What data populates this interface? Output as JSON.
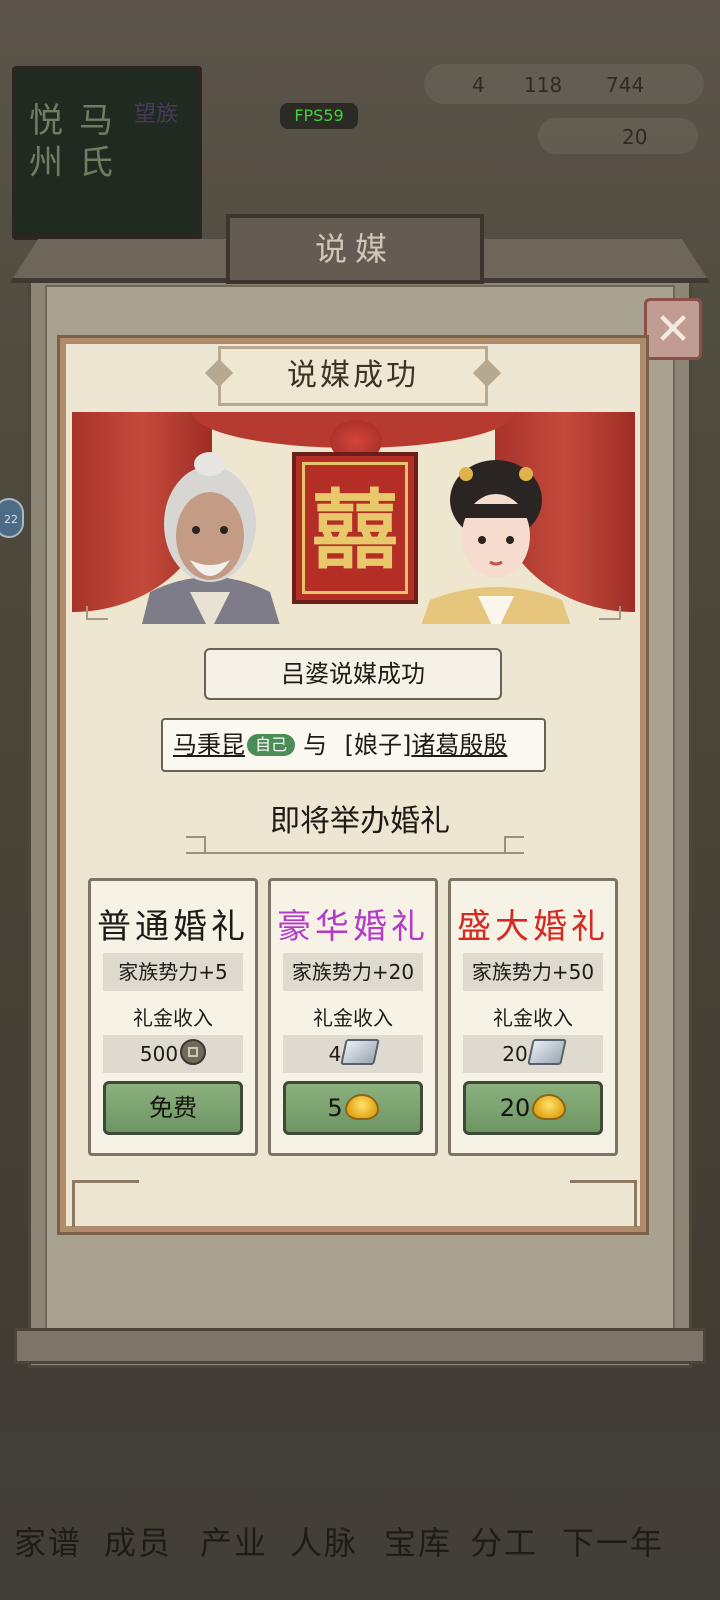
{
  "background": {
    "book_title_col1": "悦州",
    "book_title_col2": "马氏",
    "book_title_col3": "望族",
    "resources": {
      "a": "4",
      "b": "118",
      "c": "744"
    },
    "gold": "20",
    "fps": "FPS59",
    "side_badge": "22"
  },
  "dialog": {
    "title": "说媒",
    "close_icon": "close-x-icon"
  },
  "panel": {
    "ribbon_title": "说媒成功",
    "result_text": "吕婆说媒成功",
    "groom_name": "马秉昆",
    "self_tag": "自己",
    "conjunction": "与",
    "bride_prefix": "[娘子]",
    "bride_name": "诸葛殷殷",
    "soon_text": "即将举办婚礼",
    "double_happiness": "囍"
  },
  "weddings": [
    {
      "title": "普通婚礼",
      "title_color": "#1e1b17",
      "power": "家族势力+5",
      "gift_label": "礼金收入",
      "gift_value": "500",
      "gift_icon": "copper-coin-icon",
      "button_label": "免费",
      "button_icon": ""
    },
    {
      "title": "豪华婚礼",
      "title_color": "#b23cc8",
      "power": "家族势力+20",
      "gift_label": "礼金收入",
      "gift_value": "4",
      "gift_icon": "silver-ingot-icon",
      "button_label": "5",
      "button_icon": "gold-ingot-icon"
    },
    {
      "title": "盛大婚礼",
      "title_color": "#d42a22",
      "power": "家族势力+50",
      "gift_label": "礼金收入",
      "gift_value": "20",
      "gift_icon": "silver-ingot-icon",
      "button_label": "20",
      "button_icon": "gold-ingot-icon"
    }
  ],
  "bottom_nav": [
    "家谱",
    "成员",
    "产业",
    "人脉",
    "宝库",
    "分工",
    "下一年"
  ]
}
